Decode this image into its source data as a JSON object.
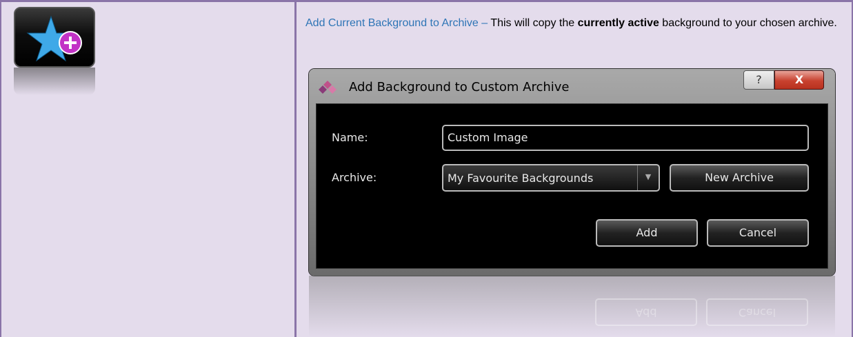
{
  "description": {
    "lead": "Add Current Background to Archive – ",
    "text_before": "This will copy the ",
    "bold": "currently active",
    "text_after": " background to your chosen archive."
  },
  "dialog": {
    "title": "Add Background to Custom Archive",
    "help_label": "?",
    "close_label": "X",
    "name_label": "Name:",
    "name_value": "Custom Image",
    "archive_label": "Archive:",
    "archive_value": "My Favourite Backgrounds",
    "new_archive_button": "New Archive",
    "add_button": "Add",
    "cancel_button": "Cancel"
  },
  "colors": {
    "cell_background": "#e4dcec",
    "border": "#8a74a8",
    "link": "#2e75b6",
    "close_button": "#c8412f"
  },
  "icons": {
    "app_icon": "star-plus-icon",
    "dialog_logo": "diamond-logo-icon"
  }
}
